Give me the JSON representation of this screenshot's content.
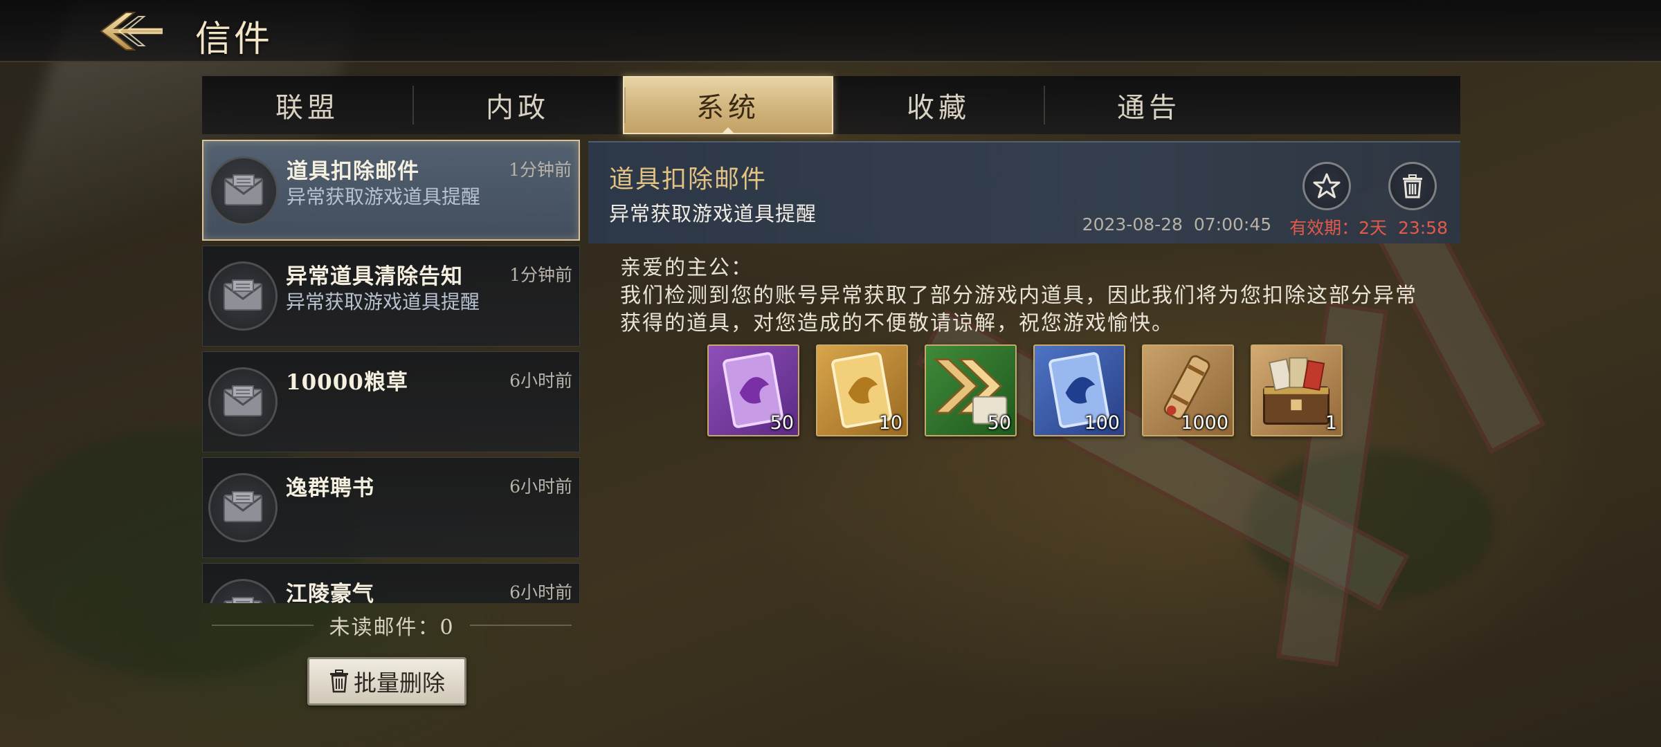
{
  "header": {
    "title": "信件"
  },
  "tabs": [
    {
      "label": "联盟",
      "active": false
    },
    {
      "label": "内政",
      "active": false
    },
    {
      "label": "系统",
      "active": true
    },
    {
      "label": "收藏",
      "active": false
    },
    {
      "label": "通告",
      "active": false
    }
  ],
  "mail_list": [
    {
      "title": "道具扣除邮件",
      "subtitle": "异常获取游戏道具提醒",
      "time": "1分钟前",
      "selected": true
    },
    {
      "title": "异常道具清除告知",
      "subtitle": "异常获取游戏道具提醒",
      "time": "1分钟前",
      "selected": false
    },
    {
      "title": "10000粮草",
      "subtitle": "",
      "time": "6小时前",
      "selected": false
    },
    {
      "title": "逸群聘书",
      "subtitle": "",
      "time": "6小时前",
      "selected": false
    },
    {
      "title": "江陵豪气",
      "subtitle": "",
      "time": "6小时前",
      "selected": false
    }
  ],
  "unread": {
    "label": "未读邮件：0"
  },
  "batch_delete_label": "批量删除",
  "detail": {
    "title": "道具扣除邮件",
    "subtitle": "异常获取游戏道具提醒",
    "datetime": "2023-08-28  07:00:45",
    "expiry": "有效期：2天  23:58",
    "greeting": "亲爱的主公：",
    "body": "我们检测到您的账号异常获取了部分游戏内道具，因此我们将为您扣除这部分异常获得的道具，对您造成的不便敬请谅解，祝您游戏愉快。",
    "rewards": [
      {
        "icon": "purple-card-icon",
        "count": "50"
      },
      {
        "icon": "gold-card-icon",
        "count": "10"
      },
      {
        "icon": "green-arrow-scroll-icon",
        "count": "50"
      },
      {
        "icon": "blue-card-icon",
        "count": "100"
      },
      {
        "icon": "telescope-icon",
        "count": "1000"
      },
      {
        "icon": "treasure-chest-icon",
        "count": "1"
      }
    ]
  },
  "colors": {
    "accent_gold": "#e2c383",
    "expiry_red": "#e25a4c",
    "active_tab": "#d8bd86"
  }
}
